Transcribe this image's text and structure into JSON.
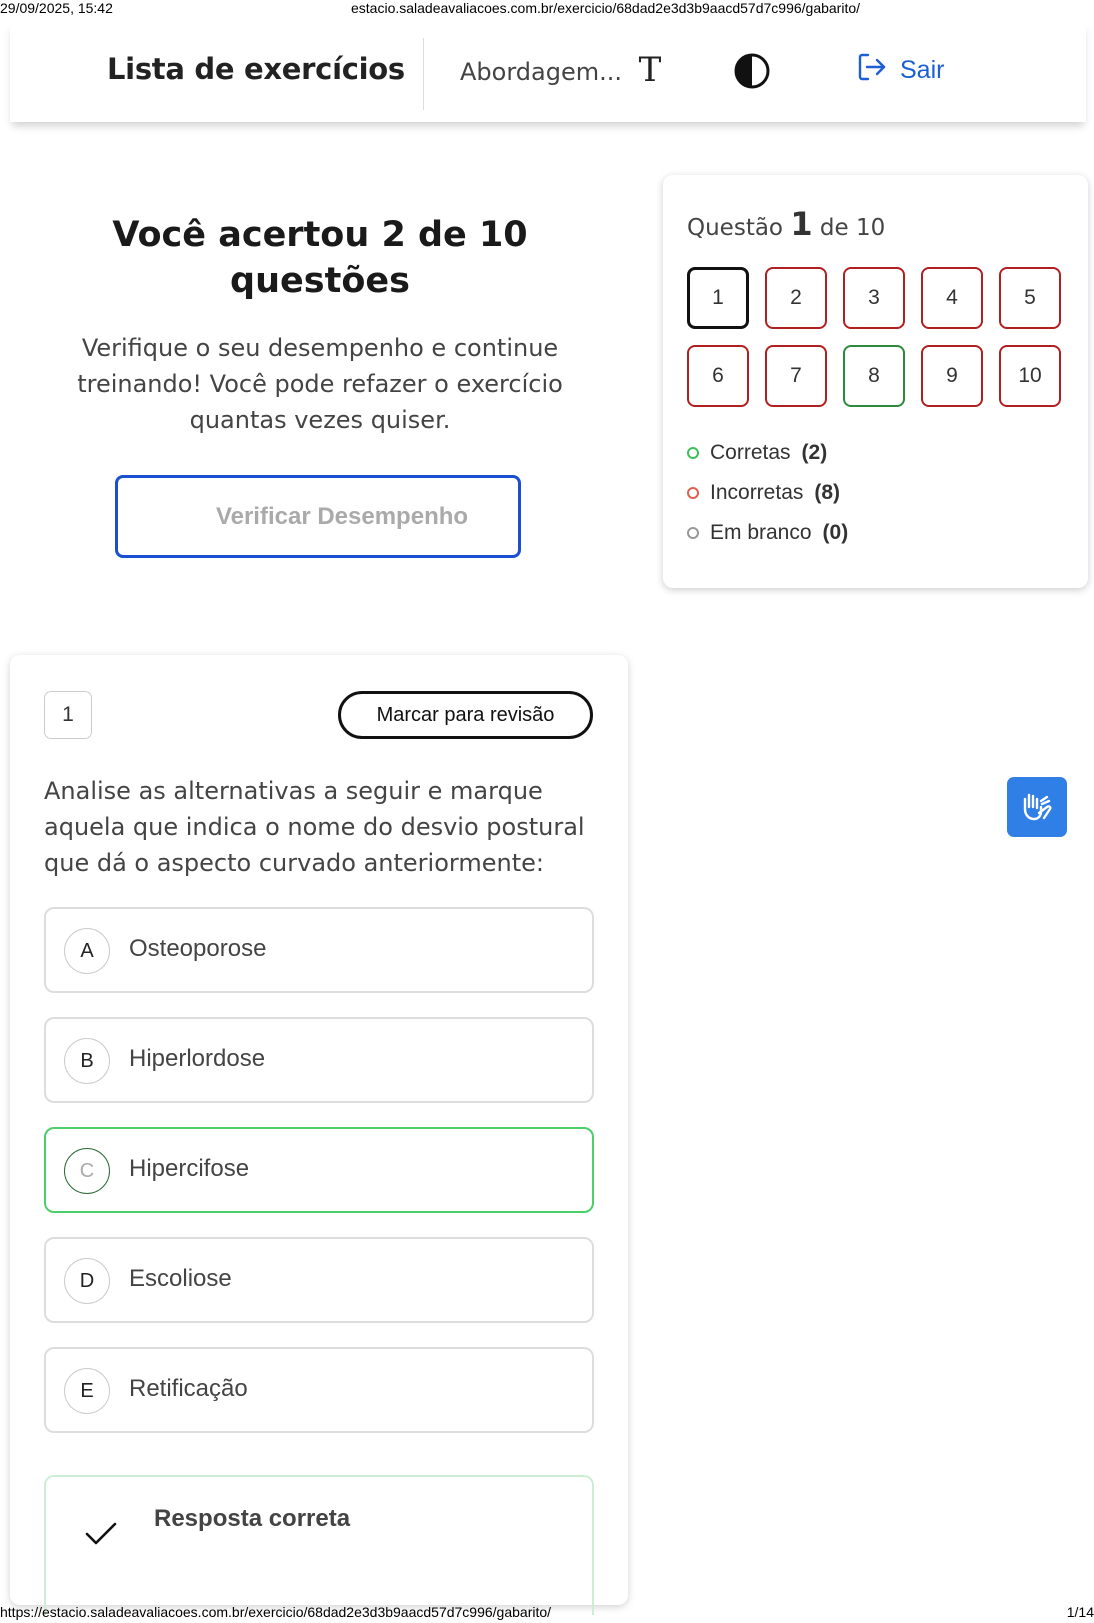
{
  "print_header": {
    "datetime": "29/09/2025, 15:42",
    "url": "estacio.saladeavaliacoes.com.br/exercicio/68dad2e3d3b9aacd57d7c996/gabarito/"
  },
  "print_footer": {
    "url": "https://estacio.saladeavaliacoes.com.br/exercicio/68dad2e3d3b9aacd57d7c996/gabarito/",
    "page": "1/14"
  },
  "topbar": {
    "title": "Lista de exercícios",
    "course": "Abordagem...",
    "font_icon_glyph": "T",
    "font_icon": "text-size-icon",
    "contrast_icon": "contrast-icon",
    "logout_label": "Sair",
    "logout_icon": "logout-icon",
    "accent_color": "#1a5fd6"
  },
  "result": {
    "title": "Você acertou 2 de 10 questões",
    "subtitle": "Verifique o seu desempenho e continue treinando! Você pode refazer o exercício quantas vezes quiser.",
    "verify_button": "Verificar Desempenho"
  },
  "navigator": {
    "prefix": "Questão",
    "current": "1",
    "suffix": "de 10",
    "questions": [
      {
        "n": "1",
        "status": "current"
      },
      {
        "n": "2",
        "status": "incorrect"
      },
      {
        "n": "3",
        "status": "incorrect"
      },
      {
        "n": "4",
        "status": "incorrect"
      },
      {
        "n": "5",
        "status": "incorrect"
      },
      {
        "n": "6",
        "status": "incorrect"
      },
      {
        "n": "7",
        "status": "incorrect"
      },
      {
        "n": "8",
        "status": "correct"
      },
      {
        "n": "9",
        "status": "incorrect"
      },
      {
        "n": "10",
        "status": "incorrect"
      }
    ],
    "legend": [
      {
        "label": "Corretas",
        "count": "(2)",
        "color": "#3fbf5a"
      },
      {
        "label": "Incorretas",
        "count": "(8)",
        "color": "#e06050"
      },
      {
        "label": "Em branco",
        "count": "(0)",
        "color": "#999999"
      }
    ]
  },
  "question": {
    "number": "1",
    "mark_button": "Marcar para revisão",
    "statement": "Analise as alternativas a seguir e marque aquela que indica o nome do desvio postural que dá o aspecto curvado anteriormente:",
    "options": [
      {
        "letter": "A",
        "text": "Osteoporose",
        "correct": false
      },
      {
        "letter": "B",
        "text": "Hiperlordose",
        "correct": false
      },
      {
        "letter": "C",
        "text": "Hipercifose",
        "correct": true
      },
      {
        "letter": "D",
        "text": "Escoliose",
        "correct": false
      },
      {
        "letter": "E",
        "text": "Retificação",
        "correct": false
      }
    ],
    "answer_label": "Resposta correta",
    "answer_icon": "check-icon"
  },
  "accessibility": {
    "vlibras_icon": "sign-language-icon",
    "vlibras_color": "#2f7fe6"
  }
}
